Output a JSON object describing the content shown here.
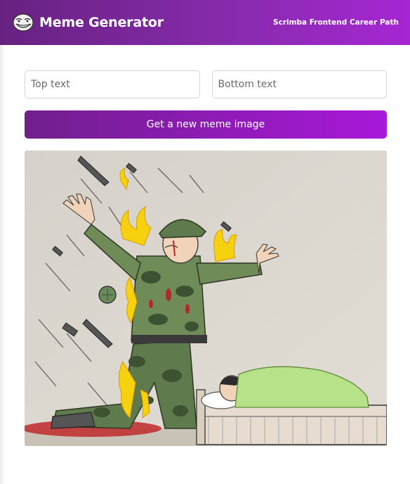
{
  "header": {
    "title": "Meme Generator",
    "subtitle": "Scrimba Frontend Career Path",
    "logo_icon": "troll-face-icon"
  },
  "form": {
    "top_text_placeholder": "Top text",
    "bottom_text_placeholder": "Bottom text",
    "top_text_value": "",
    "bottom_text_value": "",
    "submit_label": "Get a new meme image"
  },
  "meme": {
    "image": "soldier-protecting-sleeping-child-illustration",
    "top_text": "",
    "bottom_text": ""
  },
  "colors": {
    "header_start": "#672280",
    "header_end": "#a626d3",
    "button_start": "#711f8d",
    "button_end": "#a818da"
  }
}
